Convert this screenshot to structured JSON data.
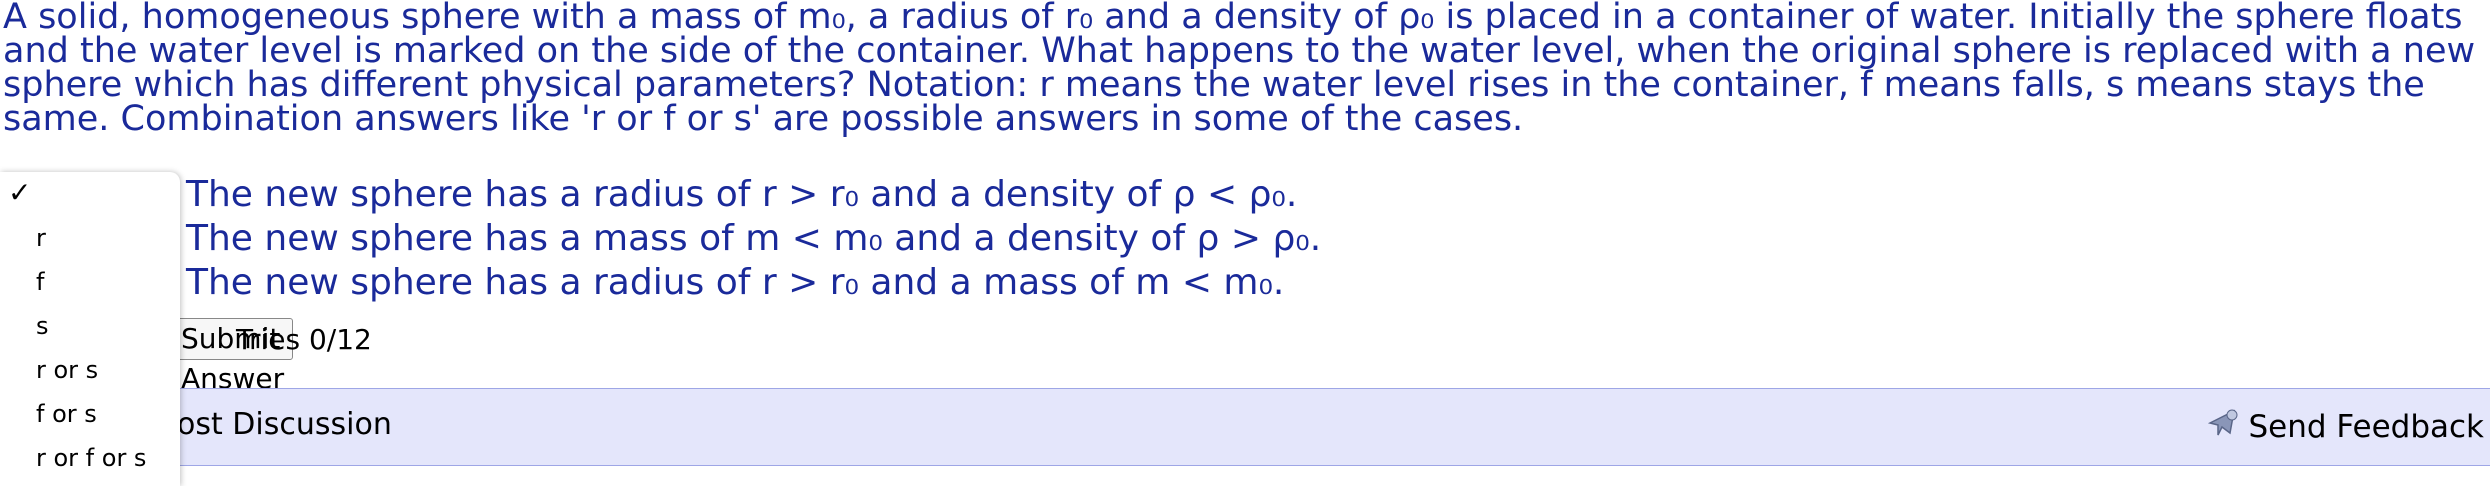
{
  "question": {
    "text": "A solid, homogeneous sphere with a mass of m₀, a radius of r₀ and a density of ρ₀ is placed in a container of water. Initially the sphere floats and the water level is marked on the side of the container. What happens to the water level, when the original sphere is replaced with a new sphere which has different physical parameters? Notation: r means the water level rises in the container, f means falls, s means stays the same. Combination answers like 'r or f or s' are possible answers in some of the cases."
  },
  "items": [
    {
      "text": "The new sphere has a radius of r > r₀ and a density of ρ < ρ₀."
    },
    {
      "text": "The new sphere has a mass of m < m₀ and a density of ρ > ρ₀."
    },
    {
      "text": "The new sphere has a radius of r > r₀ and a mass of m < m₀."
    }
  ],
  "actions": {
    "submit_label": "Submit Answer",
    "tries": "Tries 0/12"
  },
  "discussion": {
    "label": "Post Discussion",
    "feedback_label": "Send Feedback"
  },
  "dropdown": {
    "selected_mark": "✓",
    "options": [
      "r",
      "f",
      "s",
      "r or s",
      "f or s",
      "r or f or s"
    ]
  },
  "colors": {
    "question_text": "#1a2a9a",
    "discussion_bg": "#e4e6fb"
  }
}
